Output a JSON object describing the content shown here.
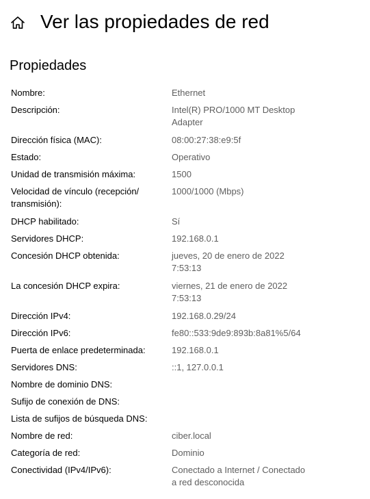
{
  "header": {
    "home_icon": "home-icon",
    "title": "Ver las propiedades de red"
  },
  "section": {
    "title": "Propiedades"
  },
  "properties": [
    {
      "label": [
        "Nombre:"
      ],
      "value": [
        "Ethernet"
      ]
    },
    {
      "label": [
        "Descripción:"
      ],
      "value": [
        "Intel(R) PRO/1000 MT Desktop",
        "Adapter"
      ]
    },
    {
      "label": [
        "Dirección física (MAC):"
      ],
      "value": [
        "08:00:27:38:e9:5f"
      ]
    },
    {
      "label": [
        "Estado:"
      ],
      "value": [
        "Operativo"
      ]
    },
    {
      "label": [
        "Unidad de transmisión máxima:"
      ],
      "value": [
        "1500"
      ]
    },
    {
      "label": [
        "Velocidad de vínculo (recepción/",
        "transmisión):"
      ],
      "value": [
        "1000/1000 (Mbps)"
      ]
    },
    {
      "label": [
        "DHCP habilitado:"
      ],
      "value": [
        "Sí"
      ]
    },
    {
      "label": [
        "Servidores DHCP:"
      ],
      "value": [
        "192.168.0.1"
      ]
    },
    {
      "label": [
        "Concesión DHCP obtenida:"
      ],
      "value": [
        "jueves, 20 de enero de 2022",
        "7:53:13"
      ]
    },
    {
      "label": [
        "La concesión DHCP expira:"
      ],
      "value": [
        "viernes, 21 de enero de 2022",
        "7:53:13"
      ]
    },
    {
      "label": [
        "Dirección IPv4:"
      ],
      "value": [
        "192.168.0.29/24"
      ]
    },
    {
      "label": [
        "Dirección IPv6:"
      ],
      "value": [
        "fe80::533:9de9:893b:8a81%5/64"
      ]
    },
    {
      "label": [
        "Puerta de enlace predeterminada:"
      ],
      "value": [
        "192.168.0.1"
      ]
    },
    {
      "label": [
        "Servidores DNS:"
      ],
      "value": [
        "::1, 127.0.0.1"
      ]
    },
    {
      "label": [
        "Nombre de dominio DNS:"
      ],
      "value": []
    },
    {
      "label": [
        "Sufijo de conexión de DNS:"
      ],
      "value": []
    },
    {
      "label": [
        "Lista de sufijos de búsqueda DNS:"
      ],
      "value": []
    },
    {
      "label": [
        "Nombre de red:"
      ],
      "value": [
        "ciber.local"
      ]
    },
    {
      "label": [
        "Categoría de red:"
      ],
      "value": [
        "Dominio"
      ]
    },
    {
      "label": [
        "Conectividad (IPv4/IPv6):"
      ],
      "value": [
        "Conectado a Internet / Conectado",
        "a red desconocida"
      ]
    }
  ]
}
